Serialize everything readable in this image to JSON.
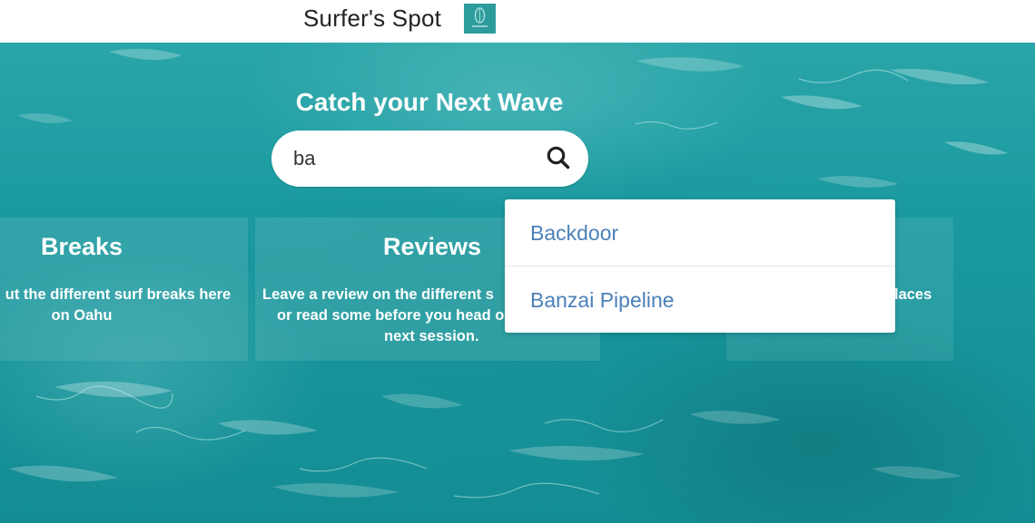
{
  "navbar": {
    "brand": "Surfer's Spot",
    "logo_icon": "surfboard-logo-icon"
  },
  "hero": {
    "title": "Catch your Next Wave",
    "search": {
      "value": "ba",
      "placeholder": "",
      "icon": "search-icon"
    }
  },
  "panels": [
    {
      "heading": "Breaks",
      "text_line1": "ut the different surf breaks here",
      "text_line2": "on Oahu"
    },
    {
      "heading": "Reviews",
      "text_line1": "Leave a review on the different s",
      "text_line2": "or read some before you head o",
      "text_line3": "next session."
    },
    {
      "text_line1": "laces"
    }
  ],
  "suggestions": [
    {
      "label": "Backdoor"
    },
    {
      "label": "Banzai Pipeline"
    }
  ],
  "colors": {
    "ocean": "#1e9ea2",
    "link": "#4a80b8",
    "logo": "#2d9c9d"
  }
}
